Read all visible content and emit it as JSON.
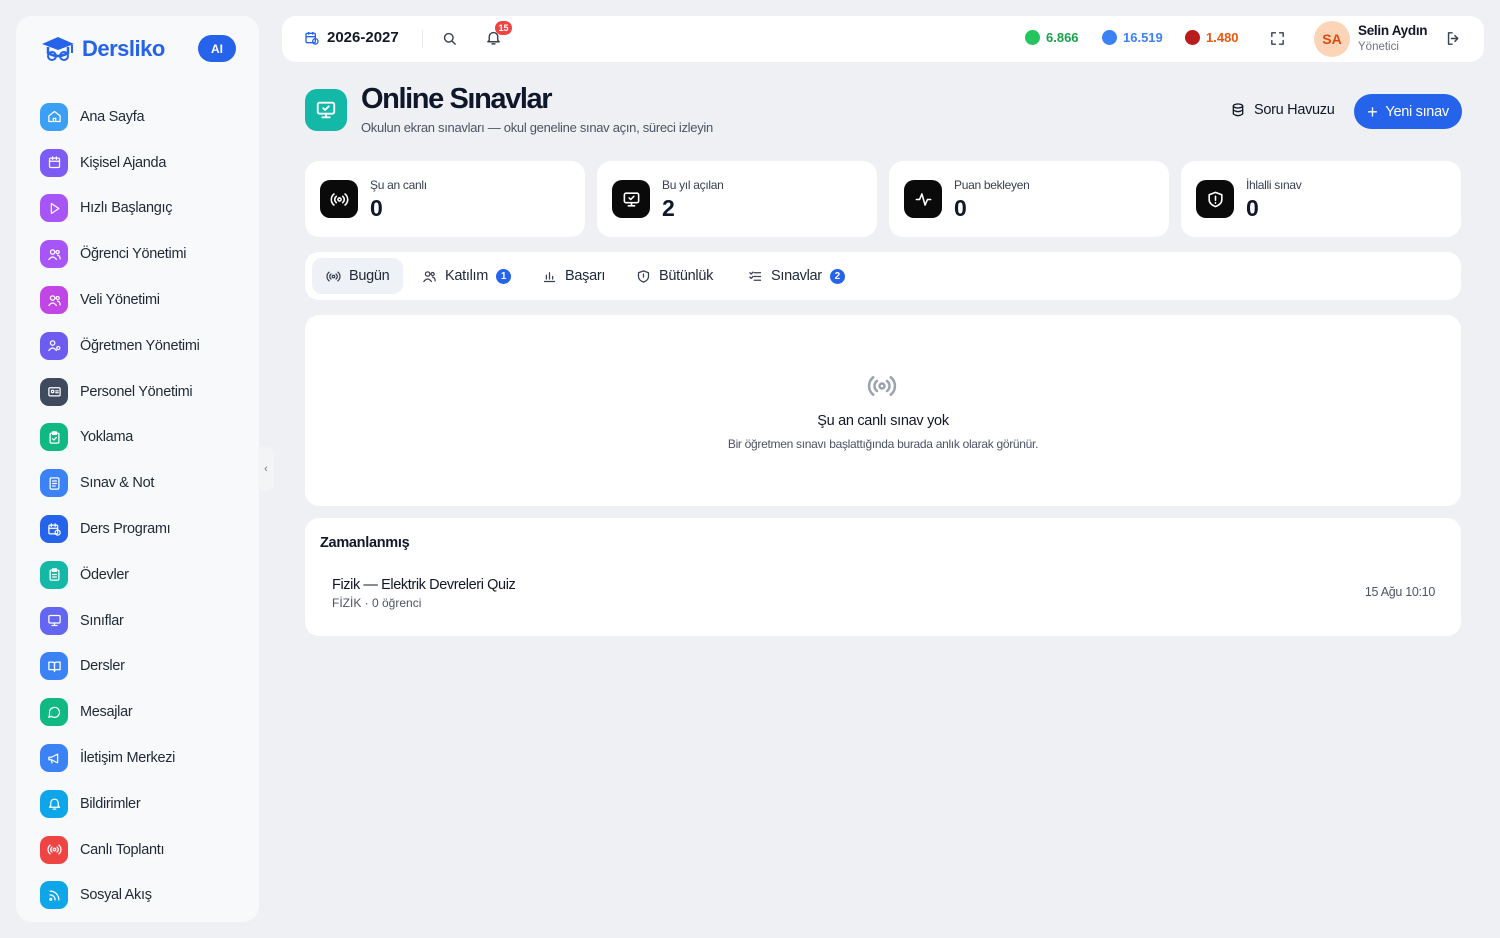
{
  "app": {
    "name": "Dersliko",
    "ai_label": "AI"
  },
  "sidebar": {
    "items": [
      {
        "label": "Ana Sayfa",
        "icon": "home-icon",
        "color": "#3b9ff5"
      },
      {
        "label": "Kişisel Ajanda",
        "icon": "calendar-icon",
        "color": "#7c5cf5"
      },
      {
        "label": "Hızlı Başlangıç",
        "icon": "play-icon",
        "color": "#a855f7"
      },
      {
        "label": "Öğrenci Yönetimi",
        "icon": "users-icon",
        "color": "#a855f7"
      },
      {
        "label": "Veli Yönetimi",
        "icon": "users-icon",
        "color": "#c046e6"
      },
      {
        "label": "Öğretmen Yönetimi",
        "icon": "user-cog-icon",
        "color": "#6d5cf0"
      },
      {
        "label": "Personel Yönetimi",
        "icon": "id-card-icon",
        "color": "#3f4a5e"
      },
      {
        "label": "Yoklama",
        "icon": "clipboard-check-icon",
        "color": "#10b981"
      },
      {
        "label": "Sınav & Not",
        "icon": "exam-icon",
        "color": "#3b82f6"
      },
      {
        "label": "Ders Programı",
        "icon": "calendar-clock-icon",
        "color": "#2563eb"
      },
      {
        "label": "Ödevler",
        "icon": "clipboard-list-icon",
        "color": "#14b8a6"
      },
      {
        "label": "Sınıflar",
        "icon": "presentation-icon",
        "color": "#6366f1"
      },
      {
        "label": "Dersler",
        "icon": "book-open-icon",
        "color": "#3b82f6"
      },
      {
        "label": "Mesajlar",
        "icon": "message-icon",
        "color": "#10b981"
      },
      {
        "label": "İletişim Merkezi",
        "icon": "megaphone-icon",
        "color": "#3b82f6"
      },
      {
        "label": "Bildirimler",
        "icon": "bell-icon",
        "color": "#0ea5e9"
      },
      {
        "label": "Canlı Toplantı",
        "icon": "broadcast-icon",
        "color": "#ef4444"
      },
      {
        "label": "Sosyal Akış",
        "icon": "rss-icon",
        "color": "#0ea5e9"
      }
    ]
  },
  "topbar": {
    "year": "2026-2027",
    "notifications": "15",
    "stats": [
      {
        "value": "6.866",
        "color": "#16a34a",
        "icon": "gem-green-icon"
      },
      {
        "value": "16.519",
        "color": "#3b82f6",
        "icon": "gem-blue-icon"
      },
      {
        "value": "1.480",
        "color": "#ea580c",
        "icon": "flame-icon"
      }
    ],
    "user": {
      "initials": "SA",
      "name": "Selin Aydın",
      "role": "Yönetici"
    }
  },
  "header": {
    "title": "Online Sınavlar",
    "subtitle": "Okulun ekran sınavları — okul geneline sınav açın, süreci izleyin",
    "pool_label": "Soru Havuzu",
    "new_label": "Yeni sınav"
  },
  "kpis": [
    {
      "label": "Şu an canlı",
      "value": "0",
      "icon": "broadcast-icon"
    },
    {
      "label": "Bu yıl açılan",
      "value": "2",
      "icon": "monitor-check-icon"
    },
    {
      "label": "Puan bekleyen",
      "value": "0",
      "icon": "activity-icon"
    },
    {
      "label": "İhlalli sınav",
      "value": "0",
      "icon": "shield-alert-icon"
    }
  ],
  "tabs": [
    {
      "label": "Bugün",
      "badge": ""
    },
    {
      "label": "Katılım",
      "badge": "1"
    },
    {
      "label": "Başarı",
      "badge": ""
    },
    {
      "label": "Bütünlük",
      "badge": ""
    },
    {
      "label": "Sınavlar",
      "badge": "2"
    }
  ],
  "empty": {
    "title": "Şu an canlı sınav yok",
    "subtitle": "Bir öğretmen sınavı başlattığında burada anlık olarak görünür."
  },
  "scheduled": {
    "title": "Zamanlanmış",
    "items": [
      {
        "name": "Fizik — Elektrik Devreleri Quiz",
        "meta": "FİZİK · 0 öğrenci",
        "date": "15 Ağu 10:10"
      }
    ]
  }
}
